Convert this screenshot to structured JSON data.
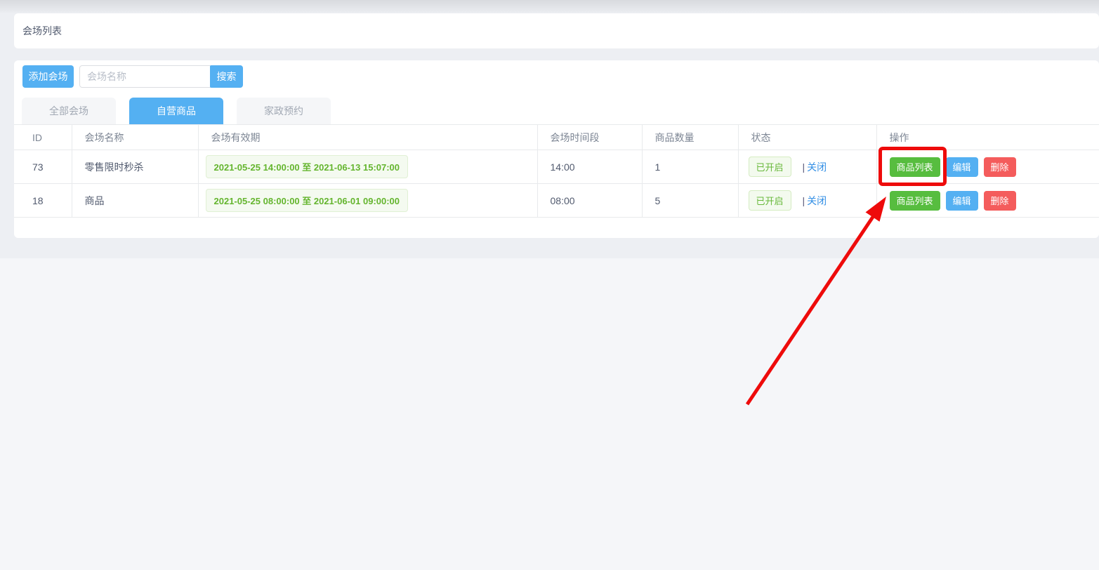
{
  "header": {
    "title": "会场列表"
  },
  "toolbar": {
    "add_button": "添加会场",
    "search_placeholder": "会场名称",
    "search_button": "搜索"
  },
  "tabs": {
    "items": [
      {
        "label": "全部会场",
        "active": false
      },
      {
        "label": "自营商品",
        "active": true
      },
      {
        "label": "家政预约",
        "active": false
      }
    ]
  },
  "table": {
    "columns": {
      "id": "ID",
      "name": "会场名称",
      "validity": "会场有效期",
      "time_slot": "会场时间段",
      "quantity": "商品数量",
      "status": "状态",
      "actions": "操作"
    },
    "rows": [
      {
        "id": "73",
        "name": "零售限时秒杀",
        "validity": "2021-05-25 14:00:00 至 2021-06-13 15:07:00",
        "time_slot": "14:00",
        "quantity": "1",
        "status_badge": "已开启",
        "separator": "|",
        "toggle_link": "关闭",
        "action_product_list": "商品列表",
        "action_edit": "编辑",
        "action_delete": "删除"
      },
      {
        "id": "18",
        "name": "商品",
        "validity": "2021-05-25 08:00:00 至 2021-06-01 09:00:00",
        "time_slot": "08:00",
        "quantity": "5",
        "status_badge": "已开启",
        "separator": "|",
        "toggle_link": "关闭",
        "action_product_list": "商品列表",
        "action_edit": "编辑",
        "action_delete": "删除"
      }
    ]
  },
  "annotation": {
    "description": "red arrow and red box highlighting the 商品列表 button of row 73"
  },
  "colors": {
    "primary_blue": "#54b0f2",
    "success_green": "#57bd3f",
    "danger_red": "#f45c5c",
    "badge_green_text": "#64b52e",
    "badge_green_bg": "#f4faf0",
    "status_green_text": "#67b83a",
    "link_blue": "#338fe5",
    "annotation_red": "#ee0b0b",
    "table_border": "#e8eaec",
    "content_bg": "#edeff3"
  }
}
